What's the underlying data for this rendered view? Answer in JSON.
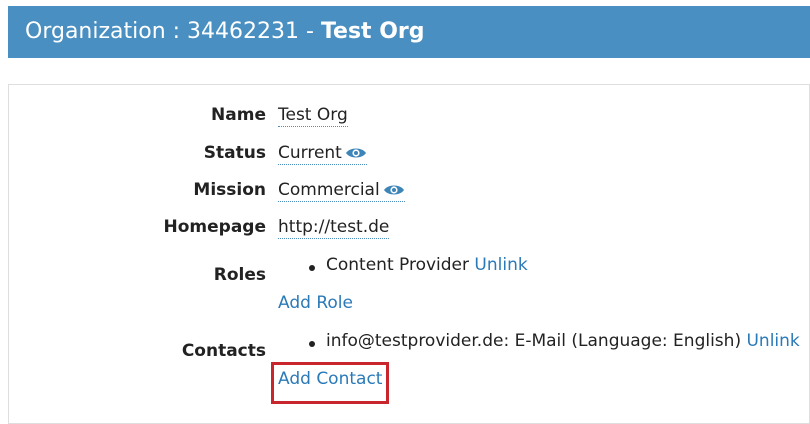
{
  "header": {
    "prefix": "Organization : 34462231 - ",
    "org_name": "Test Org"
  },
  "fields": {
    "name_label": "Name",
    "name_value": "Test Org",
    "status_label": "Status",
    "status_value": "Current",
    "mission_label": "Mission",
    "mission_value": "Commercial",
    "homepage_label": "Homepage",
    "homepage_value": "http://test.de",
    "roles_label": "Roles",
    "contacts_label": "Contacts"
  },
  "roles": {
    "items": [
      {
        "text": "Content Provider",
        "unlink_label": "Unlink"
      }
    ],
    "add_label": "Add Role"
  },
  "contacts": {
    "items": [
      {
        "text": "info@testprovider.de: E-Mail (Language: English)",
        "unlink_label": "Unlink"
      }
    ],
    "add_label": "Add Contact"
  },
  "icons": {
    "status_icon": "eye-icon",
    "mission_icon": "eye-icon"
  },
  "colors": {
    "header_bg": "#4a8fc1",
    "link": "#2a7ab8",
    "highlight": "#c8262c"
  }
}
